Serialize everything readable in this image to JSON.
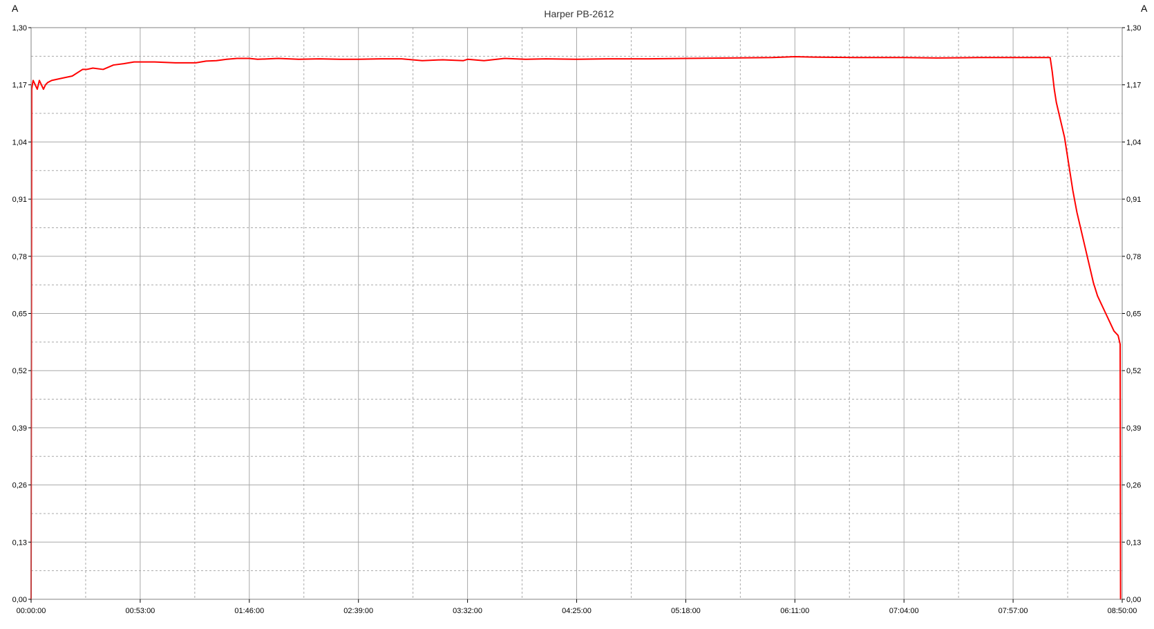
{
  "chart_data": {
    "type": "line",
    "title": "Harper PB-2612",
    "ylabel_left": "A",
    "ylabel_right": "A",
    "ylim": [
      0,
      1.3
    ],
    "y_ticks": [
      "0,00",
      "0,13",
      "0,26",
      "0,39",
      "0,52",
      "0,65",
      "0,78",
      "0,91",
      "1,04",
      "1,17",
      "1,30"
    ],
    "x_ticks": [
      "00:00:00",
      "00:53:00",
      "01:46:00",
      "02:39:00",
      "03:32:00",
      "04:25:00",
      "05:18:00",
      "06:11:00",
      "07:04:00",
      "07:57:00",
      "08:50:00"
    ],
    "xlim_minutes": [
      0,
      530
    ],
    "grid": true,
    "series": [
      {
        "color": "#ff0000",
        "x_minutes": [
          0,
          0.3,
          0.6,
          1,
          2,
          3,
          4,
          5,
          6,
          7,
          8,
          10,
          15,
          20,
          25,
          27,
          30,
          35,
          40,
          45,
          50,
          53,
          60,
          70,
          80,
          85,
          90,
          95,
          100,
          106,
          110,
          120,
          130,
          140,
          150,
          159,
          170,
          180,
          190,
          200,
          210,
          212,
          220,
          230,
          240,
          250,
          265,
          280,
          300,
          318,
          340,
          360,
          371,
          380,
          400,
          424,
          440,
          460,
          477,
          485,
          490,
          493,
          495,
          496,
          497,
          498,
          499,
          500,
          502,
          504,
          506,
          508,
          510,
          512,
          514,
          516,
          518,
          520,
          522,
          524,
          526,
          528,
          529,
          529.2
        ],
        "y": [
          0.0,
          1.16,
          1.17,
          1.18,
          1.17,
          1.16,
          1.18,
          1.17,
          1.16,
          1.17,
          1.175,
          1.18,
          1.185,
          1.19,
          1.205,
          1.205,
          1.208,
          1.205,
          1.215,
          1.218,
          1.222,
          1.222,
          1.222,
          1.22,
          1.22,
          1.224,
          1.225,
          1.228,
          1.23,
          1.23,
          1.228,
          1.23,
          1.228,
          1.229,
          1.228,
          1.228,
          1.229,
          1.229,
          1.225,
          1.227,
          1.225,
          1.228,
          1.225,
          1.23,
          1.228,
          1.229,
          1.228,
          1.229,
          1.229,
          1.23,
          1.231,
          1.232,
          1.234,
          1.233,
          1.232,
          1.232,
          1.231,
          1.232,
          1.232,
          1.232,
          1.232,
          1.232,
          1.232,
          1.2,
          1.16,
          1.13,
          1.11,
          1.09,
          1.05,
          0.99,
          0.93,
          0.88,
          0.84,
          0.8,
          0.76,
          0.72,
          0.69,
          0.67,
          0.65,
          0.63,
          0.61,
          0.6,
          0.58,
          0.0
        ]
      }
    ]
  }
}
